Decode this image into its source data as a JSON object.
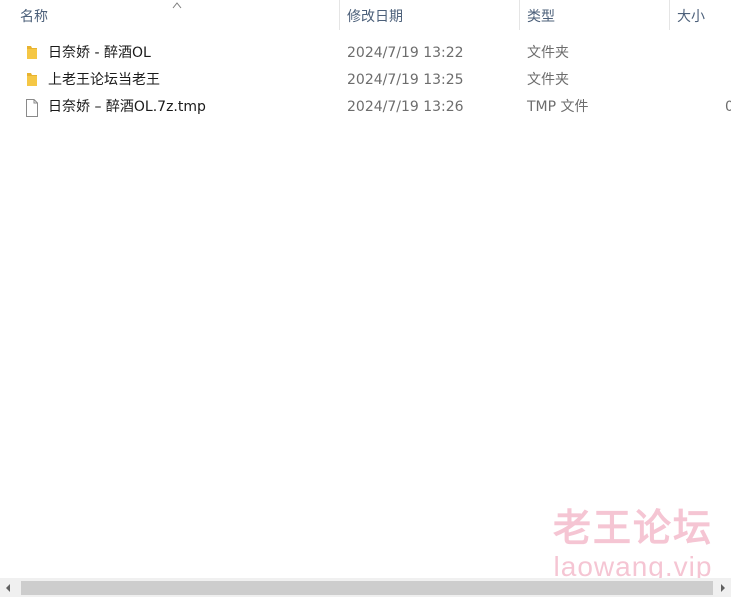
{
  "columns": {
    "name": "名称",
    "date": "修改日期",
    "type": "类型",
    "size": "大小"
  },
  "sort": {
    "column": "name",
    "direction": "ascending",
    "icon": "chevron-up-icon"
  },
  "files": [
    {
      "icon": "folder-icon",
      "name": "日奈娇 - 醉酒OL",
      "date": "2024/7/19 13:22",
      "type": "文件夹",
      "size": ""
    },
    {
      "icon": "folder-icon",
      "name": "上老王论坛当老王",
      "date": "2024/7/19 13:25",
      "type": "文件夹",
      "size": ""
    },
    {
      "icon": "file-icon",
      "name": "日奈娇 – 醉酒OL.7z.tmp",
      "date": "2024/7/19 13:26",
      "type": "TMP 文件",
      "size": "0"
    }
  ],
  "watermark": {
    "title": "老王论坛",
    "url": "laowang.vip"
  },
  "colors": {
    "header_text": "#4c607a",
    "folder": "#f5c745",
    "watermark": "#ec96af"
  }
}
